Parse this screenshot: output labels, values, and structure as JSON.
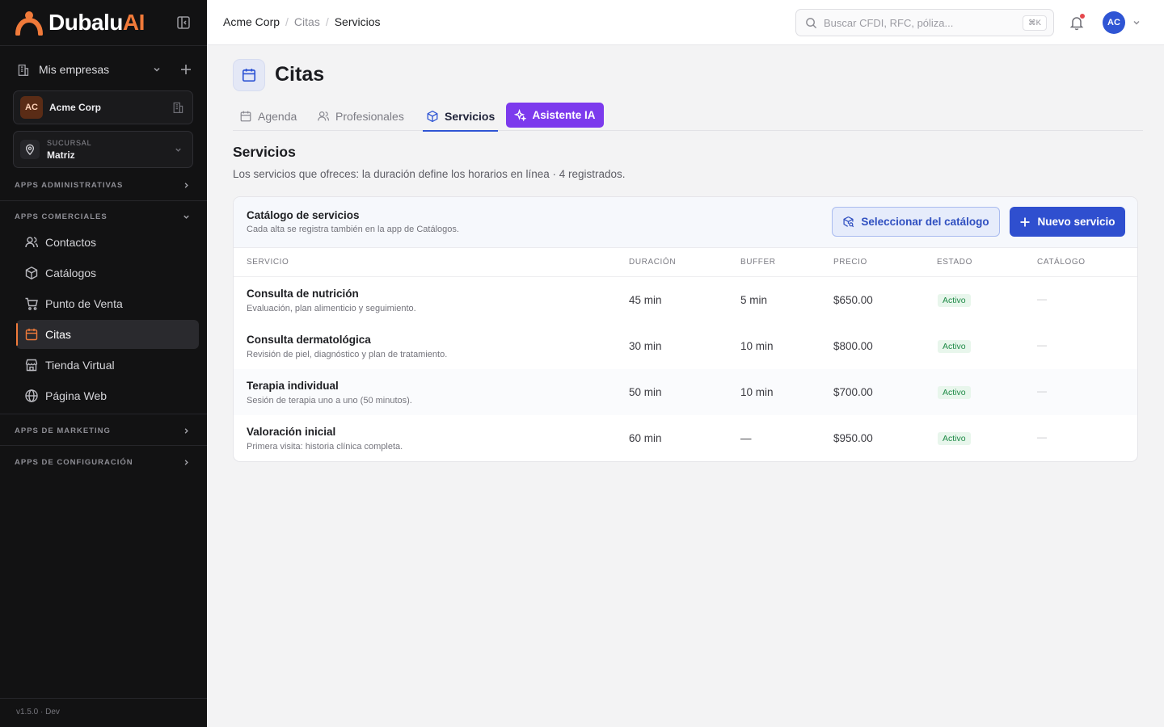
{
  "brand": {
    "name_main": "Dubalu",
    "name_accent": "AI",
    "accent_color": "#f07a3a"
  },
  "sidebar": {
    "companies_label": "Mis empresas",
    "company": {
      "initials": "AC",
      "name": "Acme Corp"
    },
    "branch": {
      "caption": "SUCURSAL",
      "value": "Matriz"
    },
    "sections": {
      "admin": "APPS ADMINISTRATIVAS",
      "commercial": "APPS COMERCIALES",
      "marketing": "APPS DE MARKETING",
      "config": "APPS DE CONFIGURACIÓN"
    },
    "items": [
      {
        "label": "Contactos",
        "icon": "users-icon"
      },
      {
        "label": "Catálogos",
        "icon": "box-icon"
      },
      {
        "label": "Punto de Venta",
        "icon": "cart-icon"
      },
      {
        "label": "Citas",
        "icon": "calendar-icon",
        "active": true
      },
      {
        "label": "Tienda Virtual",
        "icon": "store-icon"
      },
      {
        "label": "Página Web",
        "icon": "globe-icon"
      }
    ],
    "version": "v1.5.0 · Dev"
  },
  "topbar": {
    "breadcrumbs": [
      "Acme Corp",
      "Citas",
      "Servicios"
    ],
    "breadcrumb_sep": "/",
    "search_placeholder": "Buscar CFDI, RFC, póliza...",
    "search_shortcut": "⌘K",
    "avatar_initials": "AC"
  },
  "page": {
    "title": "Citas",
    "tabs": [
      {
        "label": "Agenda",
        "icon": "calendar-icon"
      },
      {
        "label": "Profesionales",
        "icon": "users-icon"
      },
      {
        "label": "Servicios",
        "icon": "box-icon",
        "active": true
      }
    ],
    "ai_button": "Asistente IA",
    "section_title": "Servicios",
    "section_subtitle": "Los servicios que ofreces: la duración define los horarios en línea · 4 registrados."
  },
  "catalog": {
    "title": "Catálogo de servicios",
    "subtitle": "Cada alta se registra también en la app de Catálogos.",
    "select_button": "Seleccionar del catálogo",
    "new_button": "Nuevo servicio",
    "columns": [
      "SERVICIO",
      "DURACIÓN",
      "BUFFER",
      "PRECIO",
      "ESTADO",
      "CATÁLOGO"
    ],
    "rows": [
      {
        "name": "Consulta de nutrición",
        "desc": "Evaluación, plan alimenticio y seguimiento.",
        "duration": "45 min",
        "buffer": "5 min",
        "price": "$650.00",
        "status": "Activo",
        "catalog": "—"
      },
      {
        "name": "Consulta dermatológica",
        "desc": "Revisión de piel, diagnóstico y plan de tratamiento.",
        "duration": "30 min",
        "buffer": "10 min",
        "price": "$800.00",
        "status": "Activo",
        "catalog": "—"
      },
      {
        "name": "Terapia individual",
        "desc": "Sesión de terapia uno a uno (50 minutos).",
        "duration": "50 min",
        "buffer": "10 min",
        "price": "$700.00",
        "status": "Activo",
        "catalog": "—"
      },
      {
        "name": "Valoración inicial",
        "desc": "Primera visita: historia clínica completa.",
        "duration": "60 min",
        "buffer": "—",
        "price": "$950.00",
        "status": "Activo",
        "catalog": "—"
      }
    ]
  },
  "colors": {
    "primary": "#2f4fcf",
    "ai_purple": "#7c3aed",
    "status_green": "#1e8a46"
  }
}
